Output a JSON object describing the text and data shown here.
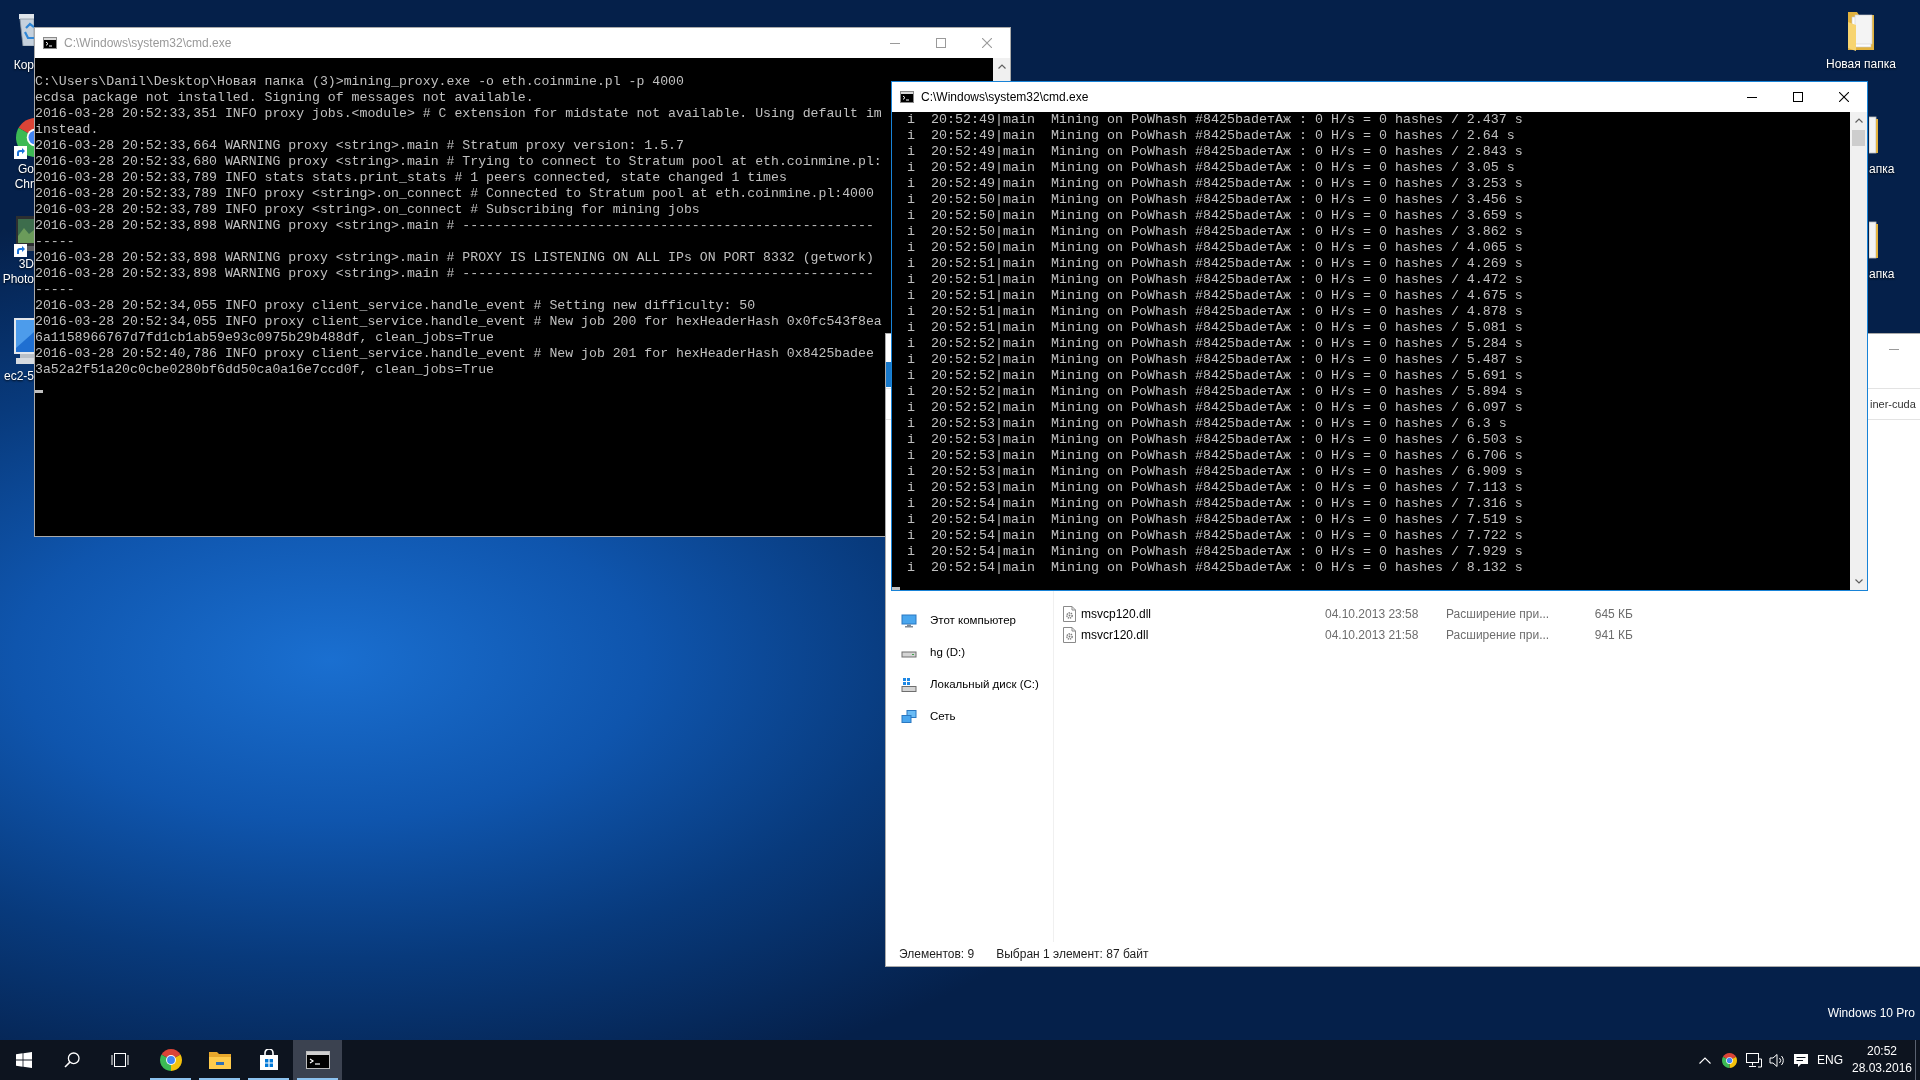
{
  "desktop": {
    "left_icons": [
      {
        "kind": "recycle_bin",
        "shortcut": false,
        "label": [
          "Кор"
        ]
      },
      {
        "kind": "browser",
        "shortcut": true,
        "label": [
          "Go",
          "Chr"
        ]
      },
      {
        "kind": "photo_viewer",
        "shortcut": true,
        "label": [
          "3D",
          "Photo"
        ]
      },
      {
        "kind": "computer",
        "shortcut": false,
        "label": [
          "ec2-5"
        ]
      }
    ],
    "right_icons": [
      {
        "kind": "folder",
        "label": [
          "Новая папка"
        ]
      },
      {
        "kind": "folder",
        "label": [
          "апка"
        ]
      },
      {
        "kind": "folder",
        "label": [
          "апка"
        ]
      }
    ],
    "edition": "Windows 10 Pro"
  },
  "proxy_console": {
    "title": "C:\\Windows\\system32\\cmd.exe",
    "active": false,
    "cursor_visible": true,
    "lines": [
      "C:\\Users\\Danil\\Desktop\\Новая папка (3)>mining_proxy.exe -o eth.coinmine.pl -p 4000",
      "ecdsa package not installed. Signing of messages not available.",
      "2016-03-28 20:52:33,351 INFO proxy jobs.<module> # C extension for midstate not available. Using default im",
      "instead.",
      "2016-03-28 20:52:33,664 WARNING proxy <string>.main # Stratum proxy version: 1.5.7",
      "2016-03-28 20:52:33,680 WARNING proxy <string>.main # Trying to connect to Stratum pool at eth.coinmine.pl:",
      "2016-03-28 20:52:33,789 INFO stats stats.print_stats # 1 peers connected, state changed 1 times",
      "2016-03-28 20:52:33,789 INFO proxy <string>.on_connect # Connected to Stratum pool at eth.coinmine.pl:4000",
      "2016-03-28 20:52:33,789 INFO proxy <string>.on_connect # Subscribing for mining jobs",
      "2016-03-28 20:52:33,898 WARNING proxy <string>.main # ----------------------------------------------------",
      "-----",
      "2016-03-28 20:52:33,898 WARNING proxy <string>.main # PROXY IS LISTENING ON ALL IPs ON PORT 8332 (getwork)",
      "2016-03-28 20:52:33,898 WARNING proxy <string>.main # ----------------------------------------------------",
      "-----",
      "2016-03-28 20:52:34,055 INFO proxy client_service.handle_event # Setting new difficulty: 50",
      "2016-03-28 20:52:34,055 INFO proxy client_service.handle_event # New job 200 for hexHeaderHash 0x0fc543f8ea",
      "6a1158966767d7fd1cb1ab59e93c0975b29b488df, clean_jobs=True",
      "2016-03-28 20:52:40,786 INFO proxy client_service.handle_event # New job 201 for hexHeaderHash 0x8425badee",
      "3a52a2f51a20c0cbe0280bf6dd50ca0a16e7ccd0f, clean_jobs=True"
    ]
  },
  "miner_console": {
    "title": "C:\\Windows\\system32\\cmd.exe",
    "active": true,
    "cursor_visible": true,
    "lines": [
      "i  20:52:49|main  Mining on PoWhash #8425badeтAж : 0 H/s = 0 hashes / 2.437 s",
      "i  20:52:49|main  Mining on PoWhash #8425badeтAж : 0 H/s = 0 hashes / 2.64 s",
      "i  20:52:49|main  Mining on PoWhash #8425badeтAж : 0 H/s = 0 hashes / 2.843 s",
      "i  20:52:49|main  Mining on PoWhash #8425badeтAж : 0 H/s = 0 hashes / 3.05 s",
      "i  20:52:49|main  Mining on PoWhash #8425badeтAж : 0 H/s = 0 hashes / 3.253 s",
      "i  20:52:50|main  Mining on PoWhash #8425badeтAж : 0 H/s = 0 hashes / 3.456 s",
      "i  20:52:50|main  Mining on PoWhash #8425badeтAж : 0 H/s = 0 hashes / 3.659 s",
      "i  20:52:50|main  Mining on PoWhash #8425badeтAж : 0 H/s = 0 hashes / 3.862 s",
      "i  20:52:50|main  Mining on PoWhash #8425badeтAж : 0 H/s = 0 hashes / 4.065 s",
      "i  20:52:51|main  Mining on PoWhash #8425badeтAж : 0 H/s = 0 hashes / 4.269 s",
      "i  20:52:51|main  Mining on PoWhash #8425badeтAж : 0 H/s = 0 hashes / 4.472 s",
      "i  20:52:51|main  Mining on PoWhash #8425badeтAж : 0 H/s = 0 hashes / 4.675 s",
      "i  20:52:51|main  Mining on PoWhash #8425badeтAж : 0 H/s = 0 hashes / 4.878 s",
      "i  20:52:51|main  Mining on PoWhash #8425badeтAж : 0 H/s = 0 hashes / 5.081 s",
      "i  20:52:52|main  Mining on PoWhash #8425badeтAж : 0 H/s = 0 hashes / 5.284 s",
      "i  20:52:52|main  Mining on PoWhash #8425badeтAж : 0 H/s = 0 hashes / 5.487 s",
      "i  20:52:52|main  Mining on PoWhash #8425badeтAж : 0 H/s = 0 hashes / 5.691 s",
      "i  20:52:52|main  Mining on PoWhash #8425badeтAж : 0 H/s = 0 hashes / 5.894 s",
      "i  20:52:52|main  Mining on PoWhash #8425badeтAж : 0 H/s = 0 hashes / 6.097 s",
      "i  20:52:53|main  Mining on PoWhash #8425badeтAж : 0 H/s = 0 hashes / 6.3 s",
      "i  20:52:53|main  Mining on PoWhash #8425badeтAж : 0 H/s = 0 hashes / 6.503 s",
      "i  20:52:53|main  Mining on PoWhash #8425badeтAж : 0 H/s = 0 hashes / 6.706 s",
      "i  20:52:53|main  Mining on PoWhash #8425badeтAж : 0 H/s = 0 hashes / 6.909 s",
      "i  20:52:53|main  Mining on PoWhash #8425badeтAж : 0 H/s = 0 hashes / 7.113 s",
      "i  20:52:54|main  Mining on PoWhash #8425badeтAж : 0 H/s = 0 hashes / 7.316 s",
      "i  20:52:54|main  Mining on PoWhash #8425badeтAж : 0 H/s = 0 hashes / 7.519 s",
      "i  20:52:54|main  Mining on PoWhash #8425badeтAж : 0 H/s = 0 hashes / 7.722 s",
      "i  20:52:54|main  Mining on PoWhash #8425badeтAж : 0 H/s = 0 hashes / 7.929 s",
      "i  20:52:54|main  Mining on PoWhash #8425badeтAж : 0 H/s = 0 hashes / 8.132 s"
    ]
  },
  "explorer": {
    "address": "iner-cuda",
    "nav_items": [
      {
        "kind": "computer",
        "label": "Этот компьютер"
      },
      {
        "kind": "drive",
        "label": "hg (D:)"
      },
      {
        "kind": "system_drive",
        "label": "Локальный диск (C:)"
      },
      {
        "kind": "network",
        "label": "Сеть"
      }
    ],
    "files": [
      {
        "name": "msvcp120.dll",
        "modified": "04.10.2013 23:58",
        "type": "Расширение при...",
        "size": "645 КБ"
      },
      {
        "name": "msvcr120.dll",
        "modified": "04.10.2013 21:58",
        "type": "Расширение при...",
        "size": "941 КБ"
      }
    ],
    "status": {
      "item_count": "Элементов: 9",
      "selection": "Выбран 1 элемент: 87 байт"
    }
  },
  "taskbar": {
    "apps": [
      {
        "kind": "browser",
        "running": true,
        "selected": false
      },
      {
        "kind": "file_explorer",
        "running": true,
        "selected": false
      },
      {
        "kind": "store",
        "running": true,
        "selected": false
      },
      {
        "kind": "console",
        "running": true,
        "selected": true
      }
    ],
    "tray": {
      "language": "ENG",
      "time": "20:52",
      "date": "28.03.2016"
    }
  }
}
